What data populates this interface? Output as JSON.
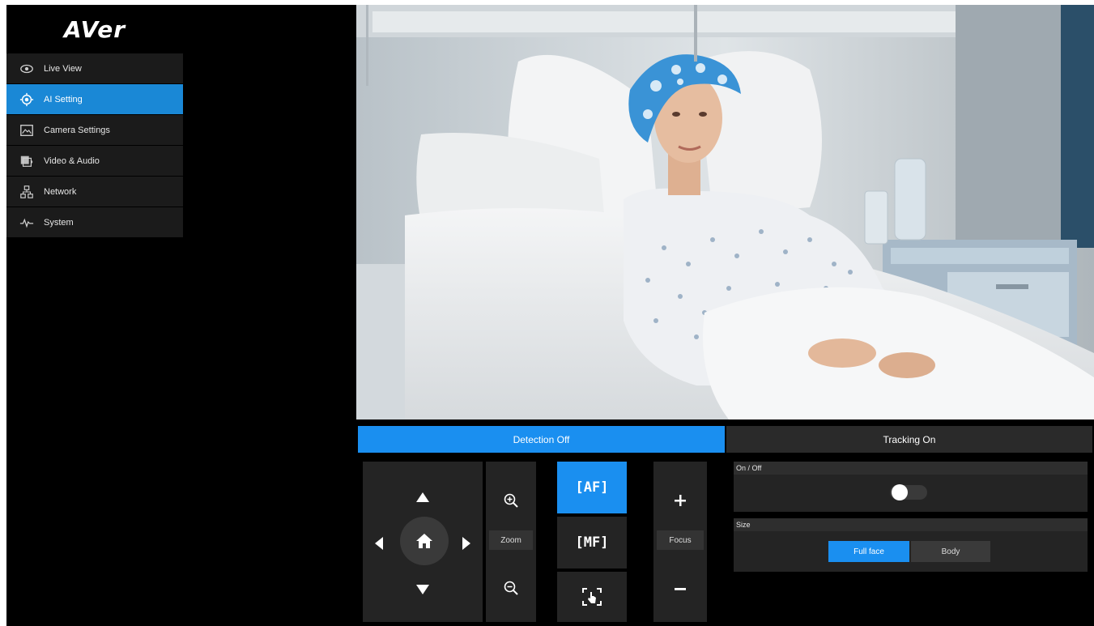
{
  "app": {
    "logo_text": "AVer"
  },
  "sidebar": {
    "items": [
      {
        "label": "Live View",
        "icon": "eye-icon",
        "active": false
      },
      {
        "label": "AI Setting",
        "icon": "target-icon",
        "active": true
      },
      {
        "label": "Camera Settings",
        "icon": "image-icon",
        "active": false
      },
      {
        "label": "Video & Audio",
        "icon": "video-audio-icon",
        "active": false
      },
      {
        "label": "Network",
        "icon": "network-icon",
        "active": false
      },
      {
        "label": "System",
        "icon": "pulse-icon",
        "active": false
      }
    ]
  },
  "tabs": {
    "detection_label": "Detection Off",
    "tracking_label": "Tracking On"
  },
  "controls": {
    "zoom_label": "Zoom",
    "focus_label": "Focus",
    "af_label": "AF",
    "mf_label": "MF"
  },
  "settings": {
    "onoff_title": "On / Off",
    "onoff_state": "on",
    "size_title": "Size",
    "size_options": [
      "Full face",
      "Body"
    ],
    "size_selected": "Full face"
  },
  "colors": {
    "accent": "#1a8ff0",
    "sidebar_active": "#1a88d6",
    "panel_bg": "#242424"
  }
}
